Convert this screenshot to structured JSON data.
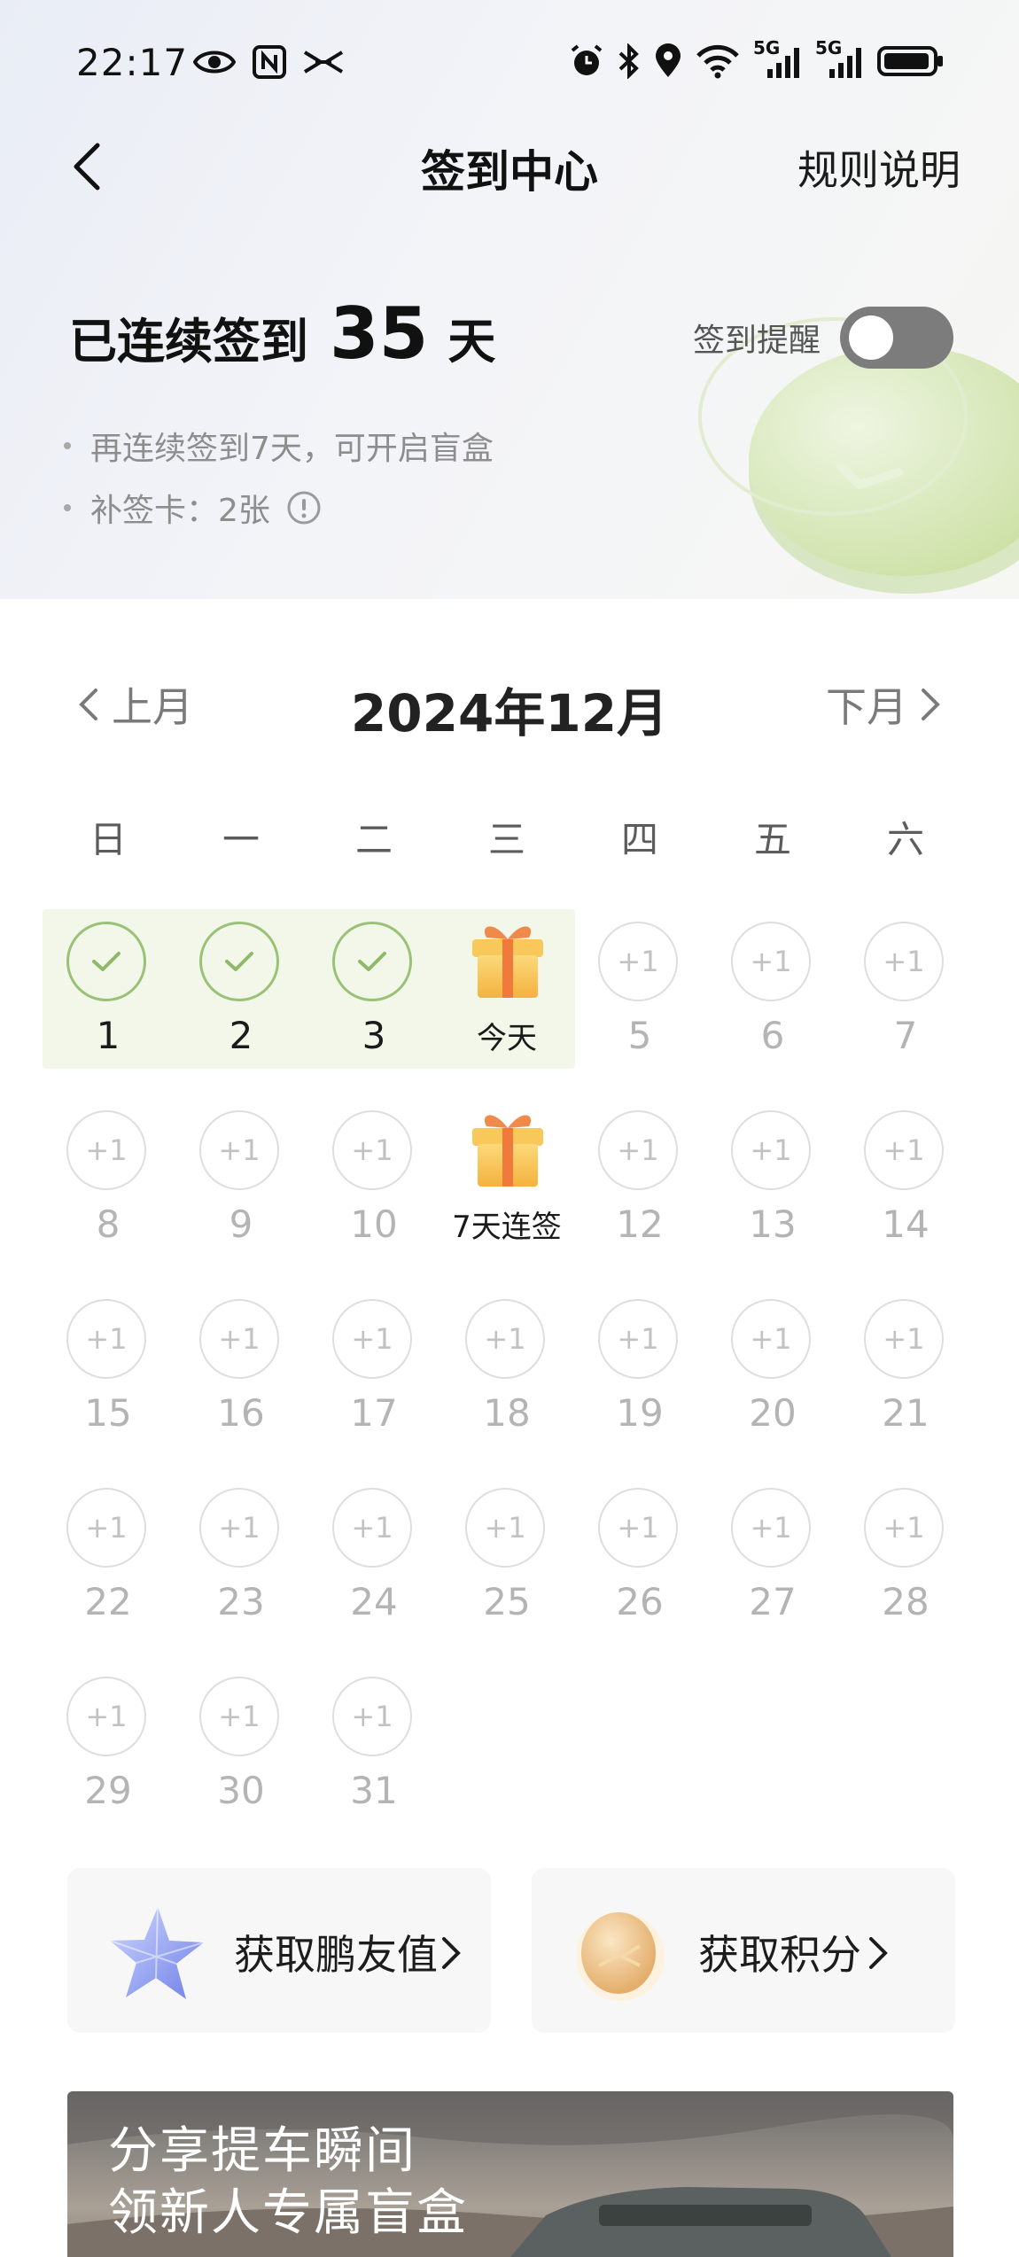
{
  "status_bar": {
    "time": "22:17",
    "network_label_1": "5G",
    "network_label_2": "5G"
  },
  "nav": {
    "title": "签到中心",
    "rules_label": "规则说明"
  },
  "summary": {
    "streak_prefix": "已连续签到",
    "streak_days": "35",
    "streak_unit": "天",
    "reminder_label": "签到提醒",
    "reminder_on": false,
    "tips": [
      "再连续签到7天，可开启盲盒",
      "补签卡：2张"
    ]
  },
  "calendar": {
    "prev_label": "上月",
    "next_label": "下月",
    "month_title": "2024年12月",
    "weekdays": [
      "日",
      "一",
      "二",
      "三",
      "四",
      "五",
      "六"
    ],
    "reward_text": "+1",
    "first_weekday": 0,
    "days": [
      {
        "n": "1",
        "state": "done"
      },
      {
        "n": "2",
        "state": "done"
      },
      {
        "n": "3",
        "state": "done"
      },
      {
        "n": "今天",
        "state": "gift"
      },
      {
        "n": "5",
        "state": "pending"
      },
      {
        "n": "6",
        "state": "pending"
      },
      {
        "n": "7",
        "state": "pending"
      },
      {
        "n": "8",
        "state": "pending"
      },
      {
        "n": "9",
        "state": "pending"
      },
      {
        "n": "10",
        "state": "pending"
      },
      {
        "n": "7天连签",
        "state": "gift"
      },
      {
        "n": "12",
        "state": "pending"
      },
      {
        "n": "13",
        "state": "pending"
      },
      {
        "n": "14",
        "state": "pending"
      },
      {
        "n": "15",
        "state": "pending"
      },
      {
        "n": "16",
        "state": "pending"
      },
      {
        "n": "17",
        "state": "pending"
      },
      {
        "n": "18",
        "state": "pending"
      },
      {
        "n": "19",
        "state": "pending"
      },
      {
        "n": "20",
        "state": "pending"
      },
      {
        "n": "21",
        "state": "pending"
      },
      {
        "n": "22",
        "state": "pending"
      },
      {
        "n": "23",
        "state": "pending"
      },
      {
        "n": "24",
        "state": "pending"
      },
      {
        "n": "25",
        "state": "pending"
      },
      {
        "n": "26",
        "state": "pending"
      },
      {
        "n": "27",
        "state": "pending"
      },
      {
        "n": "28",
        "state": "pending"
      },
      {
        "n": "29",
        "state": "pending"
      },
      {
        "n": "30",
        "state": "pending"
      },
      {
        "n": "31",
        "state": "pending"
      }
    ]
  },
  "cards": {
    "left_label": "获取鹏友值",
    "right_label": "获取积分"
  },
  "banner": {
    "line1": "分享提车瞬间",
    "line2": "领新人专属盲盒"
  },
  "colors": {
    "done_green": "#9ac277",
    "highlight_band": "#f2f7ea",
    "gift_orange": "#f5b746",
    "toggle_off": "#7c7c7c"
  }
}
